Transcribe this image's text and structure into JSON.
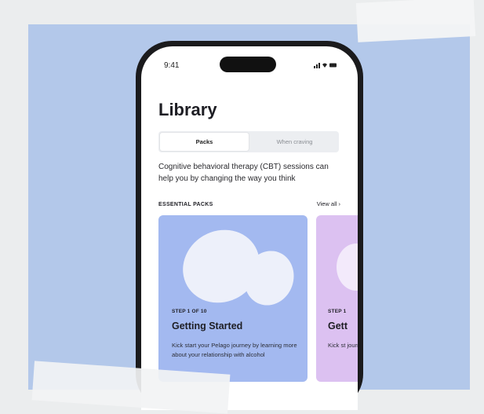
{
  "status_bar": {
    "time": "9:41",
    "icons": "signal-wifi-battery"
  },
  "library": {
    "title": "Library",
    "tabs": [
      {
        "label": "Packs",
        "selected": true
      },
      {
        "label": "When craving",
        "selected": false
      }
    ],
    "description": "Cognitive behavioral therapy (CBT) sessions can help you by changing the way you think",
    "section": {
      "title": "ESSENTIAL PACKS",
      "view_all": "View all"
    },
    "cards": [
      {
        "step": "STEP 1 OF 10",
        "title": "Getting Started",
        "description": "Kick start your Pelago journey by learning more about your relationship with alcohol",
        "color": "#a3b9f0"
      },
      {
        "step": "STEP 1",
        "title": "Gett",
        "description": "Kick st journey your re",
        "color": "#dcc1f1"
      }
    ]
  },
  "colors": {
    "backdrop": "#b3c8ea",
    "frame": "#1b1b1d"
  }
}
